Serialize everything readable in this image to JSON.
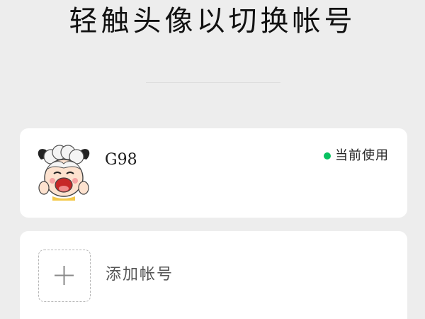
{
  "header": {
    "title": "轻触头像以切换帐号"
  },
  "accounts": [
    {
      "name": "G98",
      "status_label": "当前使用",
      "status_color": "#07c160",
      "avatar_icon": "cartoon-sheep-avatar-icon"
    }
  ],
  "add_account": {
    "label": "添加帐号",
    "icon": "plus-icon"
  },
  "colors": {
    "background": "#ededed",
    "card": "#ffffff",
    "accent_green": "#07c160"
  }
}
